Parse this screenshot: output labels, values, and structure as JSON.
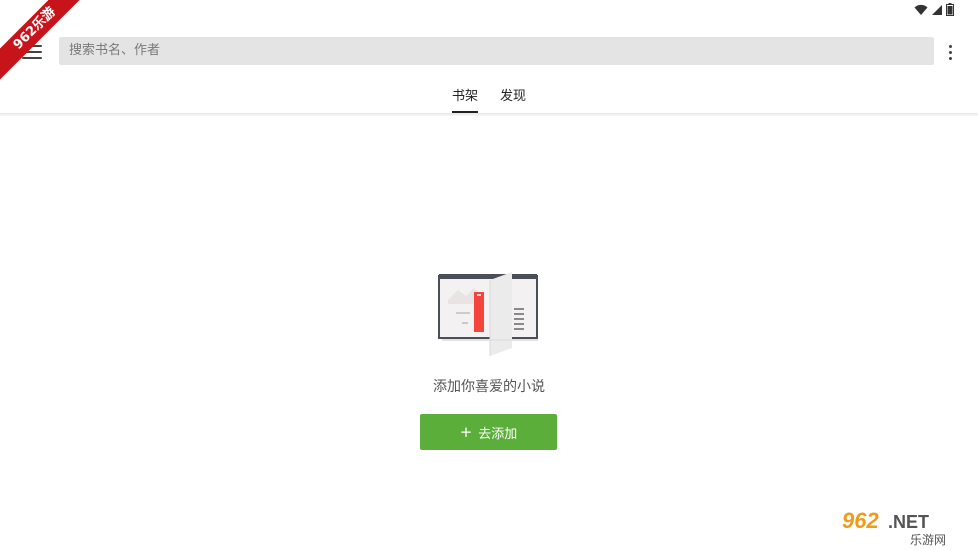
{
  "watermark": {
    "corner_text": "962乐游",
    "logo_text": "962.NET",
    "logo_subtext": "乐游网"
  },
  "search": {
    "placeholder": "搜索书名、作者"
  },
  "tabs": [
    {
      "label": "书架",
      "active": true
    },
    {
      "label": "发现",
      "active": false
    }
  ],
  "empty_state": {
    "message": "添加你喜爱的小说",
    "button_label": "去添加",
    "button_icon": "plus-icon"
  },
  "colors": {
    "accent_green": "#5cae3a",
    "ribbon_red": "#c7141b",
    "bookmark_red": "#f4453d"
  },
  "icons": [
    "wifi-icon",
    "signal-icon",
    "battery-icon",
    "menu-icon",
    "more-vert-icon",
    "book-icon"
  ]
}
